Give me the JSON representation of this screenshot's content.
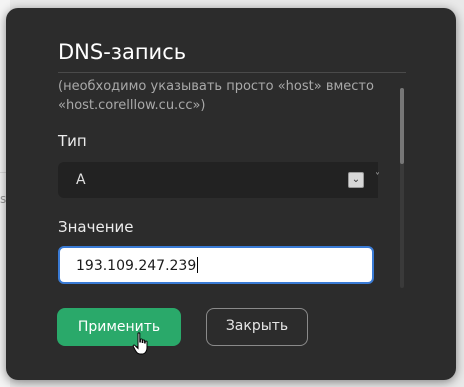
{
  "background": {
    "partial_text": "se"
  },
  "dialog": {
    "title": "DNS-запись",
    "hint": "(необходимо указывать просто «host» вместо «host.corelllow.cu.cc»)",
    "type_field": {
      "label": "Тип",
      "selected": "A"
    },
    "value_field": {
      "label": "Значение",
      "value": "193.109.247.239"
    },
    "buttons": {
      "apply": "Применить",
      "close": "Закрыть"
    }
  },
  "colors": {
    "accent": "#2aa96a",
    "focus": "#3a7bd5",
    "dialog_bg": "#2c2c2c"
  }
}
